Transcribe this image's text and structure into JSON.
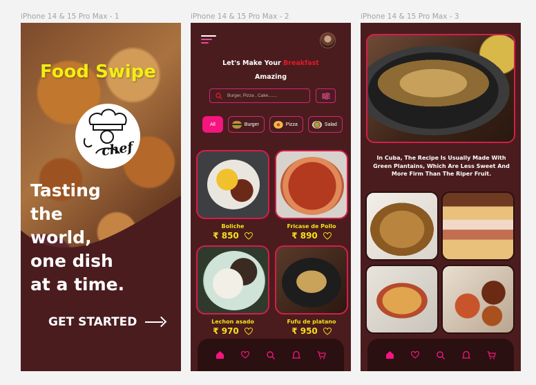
{
  "frames": [
    {
      "label": "iPhone 14 & 15 Pro Max - 1"
    },
    {
      "label": "iPhone 14 & 15 Pro Max - 2"
    },
    {
      "label": "iPhone 14 & 15 Pro Max - 3"
    }
  ],
  "splash": {
    "title": "Food Swipe",
    "logo_text": "chef",
    "tagline_lines": [
      "Tasting",
      "the",
      "world,",
      "one dish",
      "at a time."
    ],
    "cta_label": "GET STARTED",
    "title_color": "#f2ee12"
  },
  "home": {
    "heading_prefix": "Let's Make Your",
    "heading_accent": "Breakfast",
    "heading_suffix": "Amazing",
    "search_placeholder": "Burger, Pizza , Cake.......",
    "categories": [
      {
        "label": "All",
        "active": true
      },
      {
        "label": "Burger",
        "icon": "burger-icon"
      },
      {
        "label": "Pizza",
        "icon": "pizza-icon"
      },
      {
        "label": "Salad",
        "icon": "salad-icon"
      }
    ],
    "items": [
      {
        "name": "Boliche",
        "price": "₹ 850"
      },
      {
        "name": "Fricase de Pollo",
        "price": "₹ 890"
      },
      {
        "name": "Lechon asado",
        "price": "₹ 970"
      },
      {
        "name": "Fufu de platano",
        "price": "₹ 950"
      }
    ],
    "nav": [
      "home-icon",
      "heart-icon",
      "search-icon",
      "bell-icon",
      "cart-icon"
    ],
    "accent_color": "#f5157e",
    "price_color": "#f4e21a"
  },
  "detail": {
    "description": "In Cuba, The Recipe Is Usually Made With Green Plantains, Which Are Less Sweet And More Firm Than The Riper Fruit.",
    "nav": [
      "home-icon",
      "heart-icon",
      "search-icon",
      "bell-icon",
      "cart-icon"
    ]
  }
}
